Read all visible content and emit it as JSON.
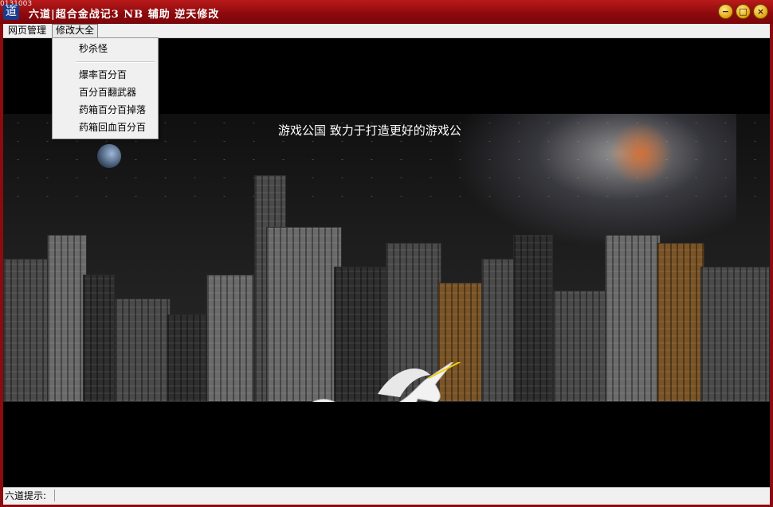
{
  "window": {
    "version": "0131003",
    "app_icon_glyph": "道",
    "title": "六道|超合金战记3 NB 辅助 逆天修改",
    "buttons": {
      "minimize": "−",
      "maximize": "□",
      "close": "×"
    }
  },
  "menubar": {
    "items": [
      {
        "label": "网页管理"
      },
      {
        "label": "修改大全"
      }
    ]
  },
  "dropdown": {
    "items": [
      {
        "label": "秒杀怪"
      },
      {
        "label": "爆率百分百"
      },
      {
        "label": "百分百翻武器"
      },
      {
        "label": "药箱百分百掉落"
      },
      {
        "label": "药箱回血百分百"
      }
    ]
  },
  "game": {
    "tagline": "游戏公国 致力于打造更好的游戏公"
  },
  "statusbar": {
    "label": "六道提示:"
  },
  "colors": {
    "title_bar": "#8e0a0e",
    "hazard_yellow": "#e6c800"
  }
}
